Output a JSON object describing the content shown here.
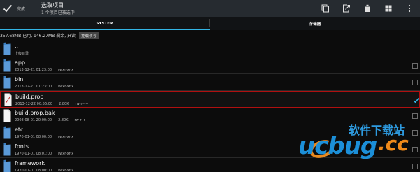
{
  "actionbar": {
    "done_label": "完成",
    "title": "选取项目",
    "subtitle": "1 个项目已被选中",
    "icons": [
      "copy-icon",
      "move-icon",
      "delete-icon",
      "select-all-icon",
      "overflow-menu-icon"
    ]
  },
  "tabs": [
    {
      "label": "SYSTEM",
      "active": true
    },
    {
      "label": "存储器",
      "active": false
    }
  ],
  "info": {
    "text": "357.68MB 已用, 146.27MB 剩余, 只读",
    "button": "挂载读写"
  },
  "files": [
    {
      "name": "..",
      "meta": [
        "上级目录"
      ],
      "type": "folder",
      "checkbox": false
    },
    {
      "name": "app",
      "meta": [
        "2013-12-21 01:23:00",
        "rwxr-xr-x"
      ],
      "type": "folder",
      "checkbox": true,
      "checked": false
    },
    {
      "name": "bin",
      "meta": [
        "2013-12-21 01:23:00",
        "rwxr-xr-x"
      ],
      "type": "folder",
      "checkbox": true,
      "checked": false
    },
    {
      "name": "build.prop",
      "meta": [
        "2013-12-22 00:56:00",
        "2.80K",
        "rw-r--r--"
      ],
      "type": "file",
      "checkbox": true,
      "checked": true
    },
    {
      "name": "build.prop.bak",
      "meta": [
        "2008-08-01 20:00:00",
        "2.80K",
        "rw-r--r--"
      ],
      "type": "file",
      "checkbox": true,
      "checked": false
    },
    {
      "name": "etc",
      "meta": [
        "1970-01-01 08:00:00",
        "rwxr-xr-x"
      ],
      "type": "folder",
      "checkbox": true,
      "checked": false
    },
    {
      "name": "fonts",
      "meta": [
        "1970-01-01 08:01:00",
        "rwxr-xr-x"
      ],
      "type": "folder",
      "checkbox": true,
      "checked": false
    },
    {
      "name": "framework",
      "meta": [
        "1970-01-01 08:00:00",
        "rwxr-xr-x"
      ],
      "type": "folder",
      "checkbox": true,
      "checked": false
    }
  ],
  "watermark": {
    "top": "软件下载站",
    "main": "ucbug",
    "tld": ".cc"
  },
  "colors": {
    "accent": "#33b5e5",
    "selected_border": "#b01010",
    "folder": "#4d8fd0",
    "check": "#33b5e5"
  }
}
